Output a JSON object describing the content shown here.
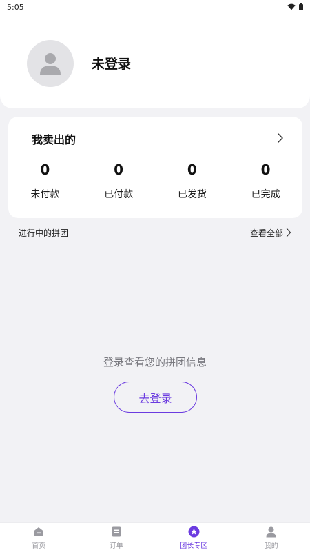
{
  "status_bar": {
    "time": "5:05"
  },
  "profile": {
    "username": "未登录",
    "avatar_icon": "avatar-placeholder-icon"
  },
  "sold": {
    "title": "我卖出的",
    "stats": [
      {
        "value": "0",
        "label": "未付款"
      },
      {
        "value": "0",
        "label": "已付款"
      },
      {
        "value": "0",
        "label": "已发货"
      },
      {
        "value": "0",
        "label": "已完成"
      }
    ]
  },
  "group_section": {
    "title": "进行中的拼团",
    "view_all": "查看全部"
  },
  "empty_state": {
    "message": "登录查看您的拼团信息",
    "login_button": "去登录"
  },
  "tabs": [
    {
      "label": "首页",
      "icon": "home-icon",
      "active": false
    },
    {
      "label": "订单",
      "icon": "order-icon",
      "active": false
    },
    {
      "label": "团长专区",
      "icon": "star-badge-icon",
      "active": true
    },
    {
      "label": "我的",
      "icon": "user-icon",
      "active": false
    }
  ],
  "colors": {
    "accent": "#6b3be0",
    "background": "#f2f2f5",
    "card": "#ffffff",
    "muted": "#9a9aa0"
  }
}
